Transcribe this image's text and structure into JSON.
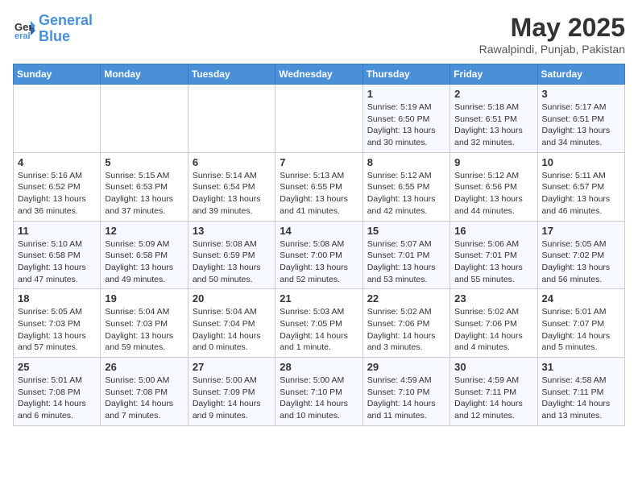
{
  "header": {
    "logo_line1": "General",
    "logo_line2": "Blue",
    "month_year": "May 2025",
    "location": "Rawalpindi, Punjab, Pakistan"
  },
  "days_of_week": [
    "Sunday",
    "Monday",
    "Tuesday",
    "Wednesday",
    "Thursday",
    "Friday",
    "Saturday"
  ],
  "weeks": [
    [
      {
        "day": "",
        "info": ""
      },
      {
        "day": "",
        "info": ""
      },
      {
        "day": "",
        "info": ""
      },
      {
        "day": "",
        "info": ""
      },
      {
        "day": "1",
        "info": "Sunrise: 5:19 AM\nSunset: 6:50 PM\nDaylight: 13 hours\nand 30 minutes."
      },
      {
        "day": "2",
        "info": "Sunrise: 5:18 AM\nSunset: 6:51 PM\nDaylight: 13 hours\nand 32 minutes."
      },
      {
        "day": "3",
        "info": "Sunrise: 5:17 AM\nSunset: 6:51 PM\nDaylight: 13 hours\nand 34 minutes."
      }
    ],
    [
      {
        "day": "4",
        "info": "Sunrise: 5:16 AM\nSunset: 6:52 PM\nDaylight: 13 hours\nand 36 minutes."
      },
      {
        "day": "5",
        "info": "Sunrise: 5:15 AM\nSunset: 6:53 PM\nDaylight: 13 hours\nand 37 minutes."
      },
      {
        "day": "6",
        "info": "Sunrise: 5:14 AM\nSunset: 6:54 PM\nDaylight: 13 hours\nand 39 minutes."
      },
      {
        "day": "7",
        "info": "Sunrise: 5:13 AM\nSunset: 6:55 PM\nDaylight: 13 hours\nand 41 minutes."
      },
      {
        "day": "8",
        "info": "Sunrise: 5:12 AM\nSunset: 6:55 PM\nDaylight: 13 hours\nand 42 minutes."
      },
      {
        "day": "9",
        "info": "Sunrise: 5:12 AM\nSunset: 6:56 PM\nDaylight: 13 hours\nand 44 minutes."
      },
      {
        "day": "10",
        "info": "Sunrise: 5:11 AM\nSunset: 6:57 PM\nDaylight: 13 hours\nand 46 minutes."
      }
    ],
    [
      {
        "day": "11",
        "info": "Sunrise: 5:10 AM\nSunset: 6:58 PM\nDaylight: 13 hours\nand 47 minutes."
      },
      {
        "day": "12",
        "info": "Sunrise: 5:09 AM\nSunset: 6:58 PM\nDaylight: 13 hours\nand 49 minutes."
      },
      {
        "day": "13",
        "info": "Sunrise: 5:08 AM\nSunset: 6:59 PM\nDaylight: 13 hours\nand 50 minutes."
      },
      {
        "day": "14",
        "info": "Sunrise: 5:08 AM\nSunset: 7:00 PM\nDaylight: 13 hours\nand 52 minutes."
      },
      {
        "day": "15",
        "info": "Sunrise: 5:07 AM\nSunset: 7:01 PM\nDaylight: 13 hours\nand 53 minutes."
      },
      {
        "day": "16",
        "info": "Sunrise: 5:06 AM\nSunset: 7:01 PM\nDaylight: 13 hours\nand 55 minutes."
      },
      {
        "day": "17",
        "info": "Sunrise: 5:05 AM\nSunset: 7:02 PM\nDaylight: 13 hours\nand 56 minutes."
      }
    ],
    [
      {
        "day": "18",
        "info": "Sunrise: 5:05 AM\nSunset: 7:03 PM\nDaylight: 13 hours\nand 57 minutes."
      },
      {
        "day": "19",
        "info": "Sunrise: 5:04 AM\nSunset: 7:03 PM\nDaylight: 13 hours\nand 59 minutes."
      },
      {
        "day": "20",
        "info": "Sunrise: 5:04 AM\nSunset: 7:04 PM\nDaylight: 14 hours\nand 0 minutes."
      },
      {
        "day": "21",
        "info": "Sunrise: 5:03 AM\nSunset: 7:05 PM\nDaylight: 14 hours\nand 1 minute."
      },
      {
        "day": "22",
        "info": "Sunrise: 5:02 AM\nSunset: 7:06 PM\nDaylight: 14 hours\nand 3 minutes."
      },
      {
        "day": "23",
        "info": "Sunrise: 5:02 AM\nSunset: 7:06 PM\nDaylight: 14 hours\nand 4 minutes."
      },
      {
        "day": "24",
        "info": "Sunrise: 5:01 AM\nSunset: 7:07 PM\nDaylight: 14 hours\nand 5 minutes."
      }
    ],
    [
      {
        "day": "25",
        "info": "Sunrise: 5:01 AM\nSunset: 7:08 PM\nDaylight: 14 hours\nand 6 minutes."
      },
      {
        "day": "26",
        "info": "Sunrise: 5:00 AM\nSunset: 7:08 PM\nDaylight: 14 hours\nand 7 minutes."
      },
      {
        "day": "27",
        "info": "Sunrise: 5:00 AM\nSunset: 7:09 PM\nDaylight: 14 hours\nand 9 minutes."
      },
      {
        "day": "28",
        "info": "Sunrise: 5:00 AM\nSunset: 7:10 PM\nDaylight: 14 hours\nand 10 minutes."
      },
      {
        "day": "29",
        "info": "Sunrise: 4:59 AM\nSunset: 7:10 PM\nDaylight: 14 hours\nand 11 minutes."
      },
      {
        "day": "30",
        "info": "Sunrise: 4:59 AM\nSunset: 7:11 PM\nDaylight: 14 hours\nand 12 minutes."
      },
      {
        "day": "31",
        "info": "Sunrise: 4:58 AM\nSunset: 7:11 PM\nDaylight: 14 hours\nand 13 minutes."
      }
    ]
  ]
}
